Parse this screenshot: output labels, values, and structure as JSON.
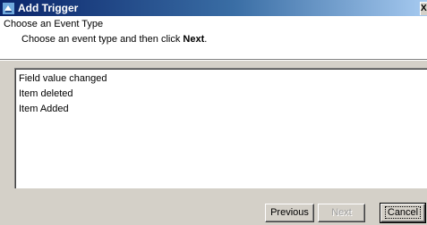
{
  "window": {
    "title": "Add Trigger",
    "close_glyph": "X"
  },
  "header": {
    "title": "Choose an Event Type",
    "instruction_prefix": "Choose an event type and then click ",
    "instruction_bold": "Next",
    "instruction_suffix": "."
  },
  "event_list": {
    "items": [
      "Field value changed",
      "Item deleted",
      "Item Added"
    ]
  },
  "buttons": {
    "previous": "Previous",
    "next": "Next",
    "cancel": "Cancel"
  }
}
